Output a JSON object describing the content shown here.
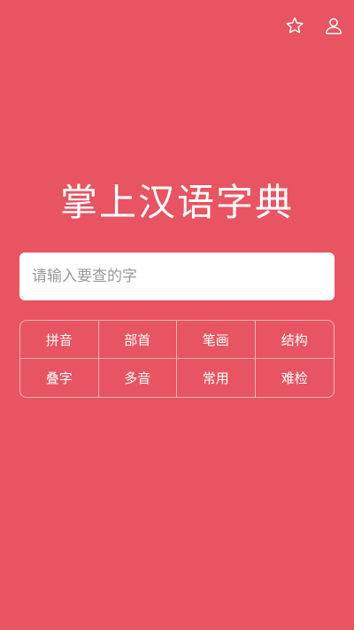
{
  "header": {
    "favorite_icon": "star-icon",
    "user_icon": "user-icon"
  },
  "title": "掌上汉语字典",
  "search": {
    "placeholder": "请输入要查的字",
    "value": ""
  },
  "lookup_modes": [
    {
      "label": "拼音"
    },
    {
      "label": "部首"
    },
    {
      "label": "笔画"
    },
    {
      "label": "结构"
    },
    {
      "label": "叠字"
    },
    {
      "label": "多音"
    },
    {
      "label": "常用"
    },
    {
      "label": "难检"
    }
  ],
  "colors": {
    "background": "#e85461",
    "text": "#ffffff"
  }
}
